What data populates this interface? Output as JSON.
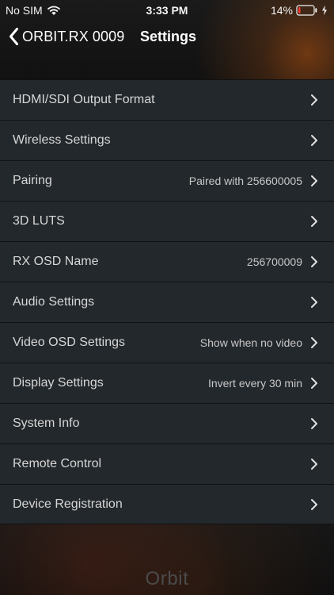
{
  "status_bar": {
    "carrier": "No SIM",
    "time": "3:33 PM",
    "battery_percent_text": "14%",
    "battery_level": 0.14,
    "icons": [
      "wifi-icon",
      "battery-icon",
      "charging-bolt-icon"
    ]
  },
  "navigation": {
    "back_label": "ORBIT.RX 0009",
    "title": "Settings",
    "icons": [
      "chevron-left-icon"
    ]
  },
  "settings": {
    "rows": [
      {
        "label": "HDMI/SDI Output Format",
        "detail": "",
        "icon": "chevron-right-icon"
      },
      {
        "label": "Wireless Settings",
        "detail": "",
        "icon": "chevron-right-icon"
      },
      {
        "label": "Pairing",
        "detail": "Paired with 256600005",
        "icon": "chevron-right-icon"
      },
      {
        "label": "3D LUTS",
        "detail": "",
        "icon": "chevron-right-icon"
      },
      {
        "label": "RX OSD Name",
        "detail": "256700009",
        "icon": "chevron-right-icon"
      },
      {
        "label": "Audio Settings",
        "detail": "",
        "icon": "chevron-right-icon"
      },
      {
        "label": "Video OSD Settings",
        "detail": "Show when no video",
        "icon": "chevron-right-icon"
      },
      {
        "label": "Display Settings",
        "detail": "Invert every 30 min",
        "icon": "chevron-right-icon"
      },
      {
        "label": "System Info",
        "detail": "",
        "icon": "chevron-right-icon"
      },
      {
        "label": "Remote Control",
        "detail": "",
        "icon": "chevron-right-icon"
      },
      {
        "label": "Device Registration",
        "detail": "",
        "icon": "chevron-right-icon"
      }
    ]
  },
  "brand": {
    "watermark": "Orbit"
  },
  "colors": {
    "row_background": "#23282c",
    "row_label": "#d6d6d6",
    "row_detail": "#c8c8c8",
    "battery_low": "#ff3b30"
  }
}
